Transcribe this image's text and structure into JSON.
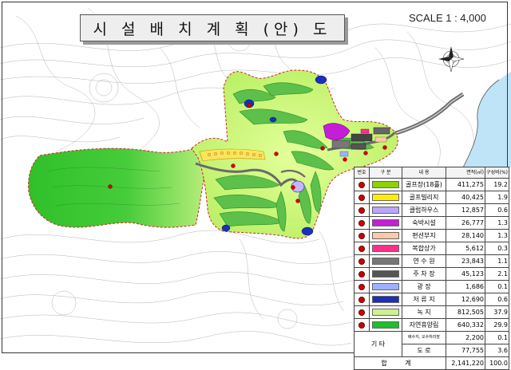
{
  "title": "시 설 배 치 계 획 (안) 도",
  "scale": "SCALE 1 : 4,000",
  "legend": {
    "headers": [
      "번호",
      "구 분",
      "내 용",
      "면적(㎡)",
      "구성비(%)"
    ],
    "rows": [
      {
        "name": "골프장(18홀)",
        "area": "411,275",
        "pct": "19.2",
        "color": "#8cd300"
      },
      {
        "name": "골프빌리지",
        "area": "40,425",
        "pct": "1.9",
        "color": "#ffee00"
      },
      {
        "name": "클럽하우스",
        "area": "12,857",
        "pct": "0.6",
        "color": "#b9a6ff"
      },
      {
        "name": "숙박시설",
        "area": "26,777",
        "pct": "1.3",
        "color": "#c21fd6"
      },
      {
        "name": "편션부지",
        "area": "28,140",
        "pct": "1.3",
        "color": "#ffc9a8"
      },
      {
        "name": "복합상가",
        "area": "5,612",
        "pct": "0.3",
        "color": "#ff2f8a"
      },
      {
        "name": "연 수 원",
        "area": "23,843",
        "pct": "1.1",
        "color": "#777777"
      },
      {
        "name": "주 차 장",
        "area": "45,123",
        "pct": "2.1",
        "color": "#555555"
      },
      {
        "name": "광      장",
        "area": "1,686",
        "pct": "0.1",
        "color": "#9fb0ff"
      },
      {
        "name": "저 류 지",
        "area": "12,690",
        "pct": "0.6",
        "color": "#1c2fb8"
      },
      {
        "name": "녹      지",
        "area": "812,505",
        "pct": "37.9",
        "color": "#cfef95"
      },
      {
        "name": "자연휴양림",
        "area": "640,332",
        "pct": "29.9",
        "color": "#1fbf2a"
      }
    ],
    "etc_label": "기   타",
    "etc_rows": [
      {
        "name": "배수지, 오수처리장",
        "area": "2,200",
        "pct": "0.1"
      },
      {
        "name": "도      로",
        "area": "77,755",
        "pct": "3.6"
      }
    ],
    "total_label": "합  계",
    "total_area": "2,141,220",
    "total_pct": "100.0"
  }
}
